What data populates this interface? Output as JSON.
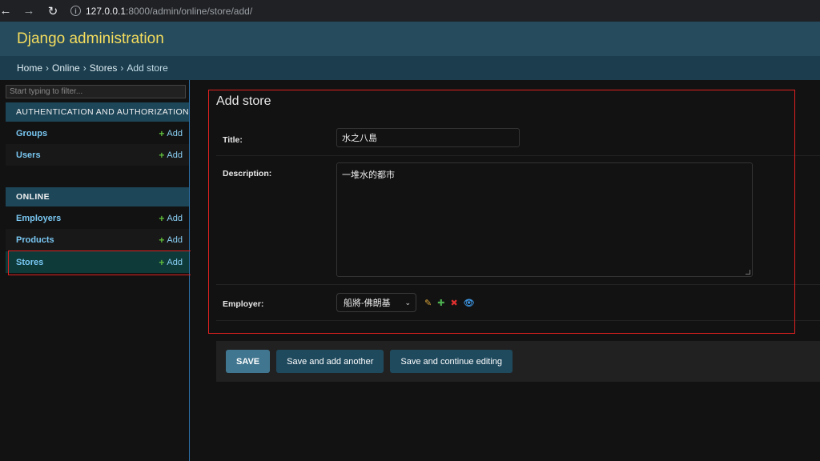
{
  "browser": {
    "url_host": "127.0.0.1",
    "url_rest": ":8000/admin/online/store/add/"
  },
  "header": {
    "site_title": "Django administration"
  },
  "breadcrumbs": {
    "home": "Home",
    "app": "Online",
    "model": "Stores",
    "current": "Add store",
    "separator": "›"
  },
  "sidebar": {
    "filter_placeholder": "Start typing to filter...",
    "modules": [
      {
        "caption": "AUTHENTICATION AND AUTHORIZATION",
        "models": [
          {
            "name": "Groups",
            "add": "Add"
          },
          {
            "name": "Users",
            "add": "Add"
          }
        ]
      },
      {
        "caption": "ONLINE",
        "models": [
          {
            "name": "Employers",
            "add": "Add"
          },
          {
            "name": "Products",
            "add": "Add"
          },
          {
            "name": "Stores",
            "add": "Add"
          }
        ]
      }
    ]
  },
  "form": {
    "title": "Add store",
    "fields": {
      "title": {
        "label": "Title:",
        "value": "水之八島"
      },
      "description": {
        "label": "Description:",
        "value": "一堆水的都市"
      },
      "employer": {
        "label": "Employer:",
        "value": "船將-佛朗基"
      }
    },
    "buttons": {
      "save": "SAVE",
      "save_add_another": "Save and add another",
      "save_continue": "Save and continue editing"
    }
  },
  "colors": {
    "header_bg": "#264b5d",
    "site_title": "#f5dd5d",
    "link": "#79c7f2",
    "primary_button": "#417690",
    "highlight_box": "#e02020"
  },
  "icons": {
    "edit": "pencil-icon",
    "add": "plus-icon",
    "delete": "cross-icon",
    "view": "eye-icon"
  }
}
